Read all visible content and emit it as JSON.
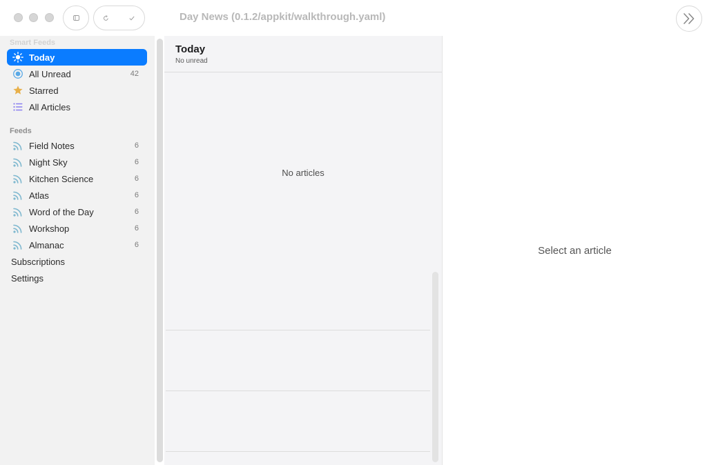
{
  "window": {
    "title": "Day News (0.1.2/appkit/walkthrough.yaml)"
  },
  "toolbar": {
    "traffic_lights": [
      "close",
      "minimize",
      "zoom"
    ],
    "sidebar_toggle_icon": "sidebar-icon",
    "refresh_icon": "refresh-icon",
    "mark_read_icon": "checkmark-icon",
    "expand_icon": "chevron-double-right-icon"
  },
  "sidebar": {
    "smart_feeds_header": "Smart Feeds",
    "smart_feeds": [
      {
        "label": "Today",
        "count": "",
        "icon": "sun-icon",
        "selected": true
      },
      {
        "label": "All Unread",
        "count": "42",
        "icon": "unread-circle-icon",
        "selected": false
      },
      {
        "label": "Starred",
        "count": "",
        "icon": "star-icon",
        "selected": false
      },
      {
        "label": "All Articles",
        "count": "",
        "icon": "list-icon",
        "selected": false
      }
    ],
    "feeds_header": "Feeds",
    "feeds": [
      {
        "label": "Field Notes",
        "count": "6",
        "icon": "rss-icon"
      },
      {
        "label": "Night Sky",
        "count": "6",
        "icon": "rss-icon"
      },
      {
        "label": "Kitchen Science",
        "count": "6",
        "icon": "rss-icon"
      },
      {
        "label": "Atlas",
        "count": "6",
        "icon": "rss-icon"
      },
      {
        "label": "Word of the Day",
        "count": "6",
        "icon": "rss-icon"
      },
      {
        "label": "Workshop",
        "count": "6",
        "icon": "rss-icon"
      },
      {
        "label": "Almanac",
        "count": "6",
        "icon": "rss-icon"
      }
    ],
    "subscriptions_label": "Subscriptions",
    "settings_label": "Settings"
  },
  "list": {
    "title": "Today",
    "subtitle": "No unread",
    "empty_text": "No articles"
  },
  "detail": {
    "empty_text": "Select an article"
  },
  "colors": {
    "accent": "#0a7cff",
    "rss": "#7fb8cf",
    "star": "#e8b04a",
    "list_icon": "#8a7ff0"
  }
}
